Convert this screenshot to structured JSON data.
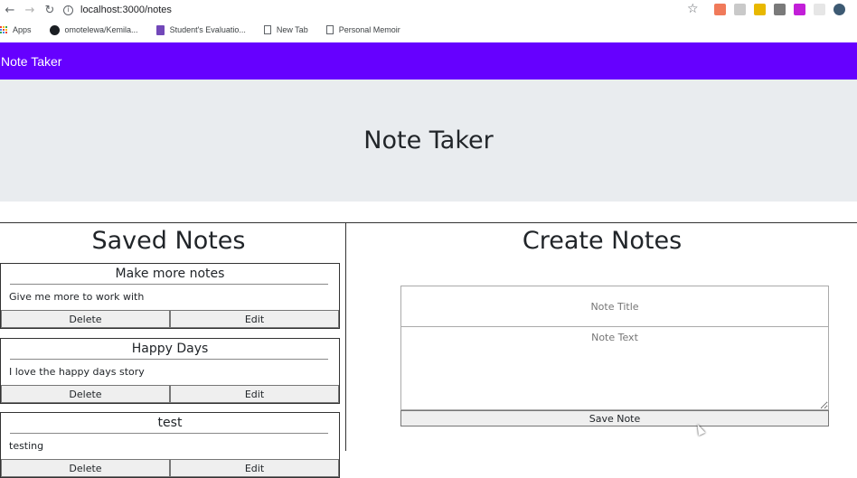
{
  "browser": {
    "url": "localhost:3000/notes",
    "bookmarks": [
      {
        "label": "Apps"
      },
      {
        "label": "omotelewa/Kemila..."
      },
      {
        "label": "Student's Evaluatio..."
      },
      {
        "label": "New Tab"
      },
      {
        "label": "Personal Memoir"
      }
    ]
  },
  "navbar": {
    "brand": "Note Taker"
  },
  "jumbotron": {
    "title": "Note Taker"
  },
  "saved": {
    "title": "Saved Notes",
    "notes": [
      {
        "title": "Make more notes",
        "text": "Give me more to work with",
        "delete_label": "Delete",
        "edit_label": "Edit"
      },
      {
        "title": "Happy Days",
        "text": "I love the happy days story",
        "delete_label": "Delete",
        "edit_label": "Edit"
      },
      {
        "title": "test",
        "text": "testing",
        "delete_label": "Delete",
        "edit_label": "Edit"
      }
    ]
  },
  "create": {
    "title": "Create Notes",
    "title_placeholder": "Note Title",
    "text_placeholder": "Note Text",
    "save_label": "Save Note"
  }
}
